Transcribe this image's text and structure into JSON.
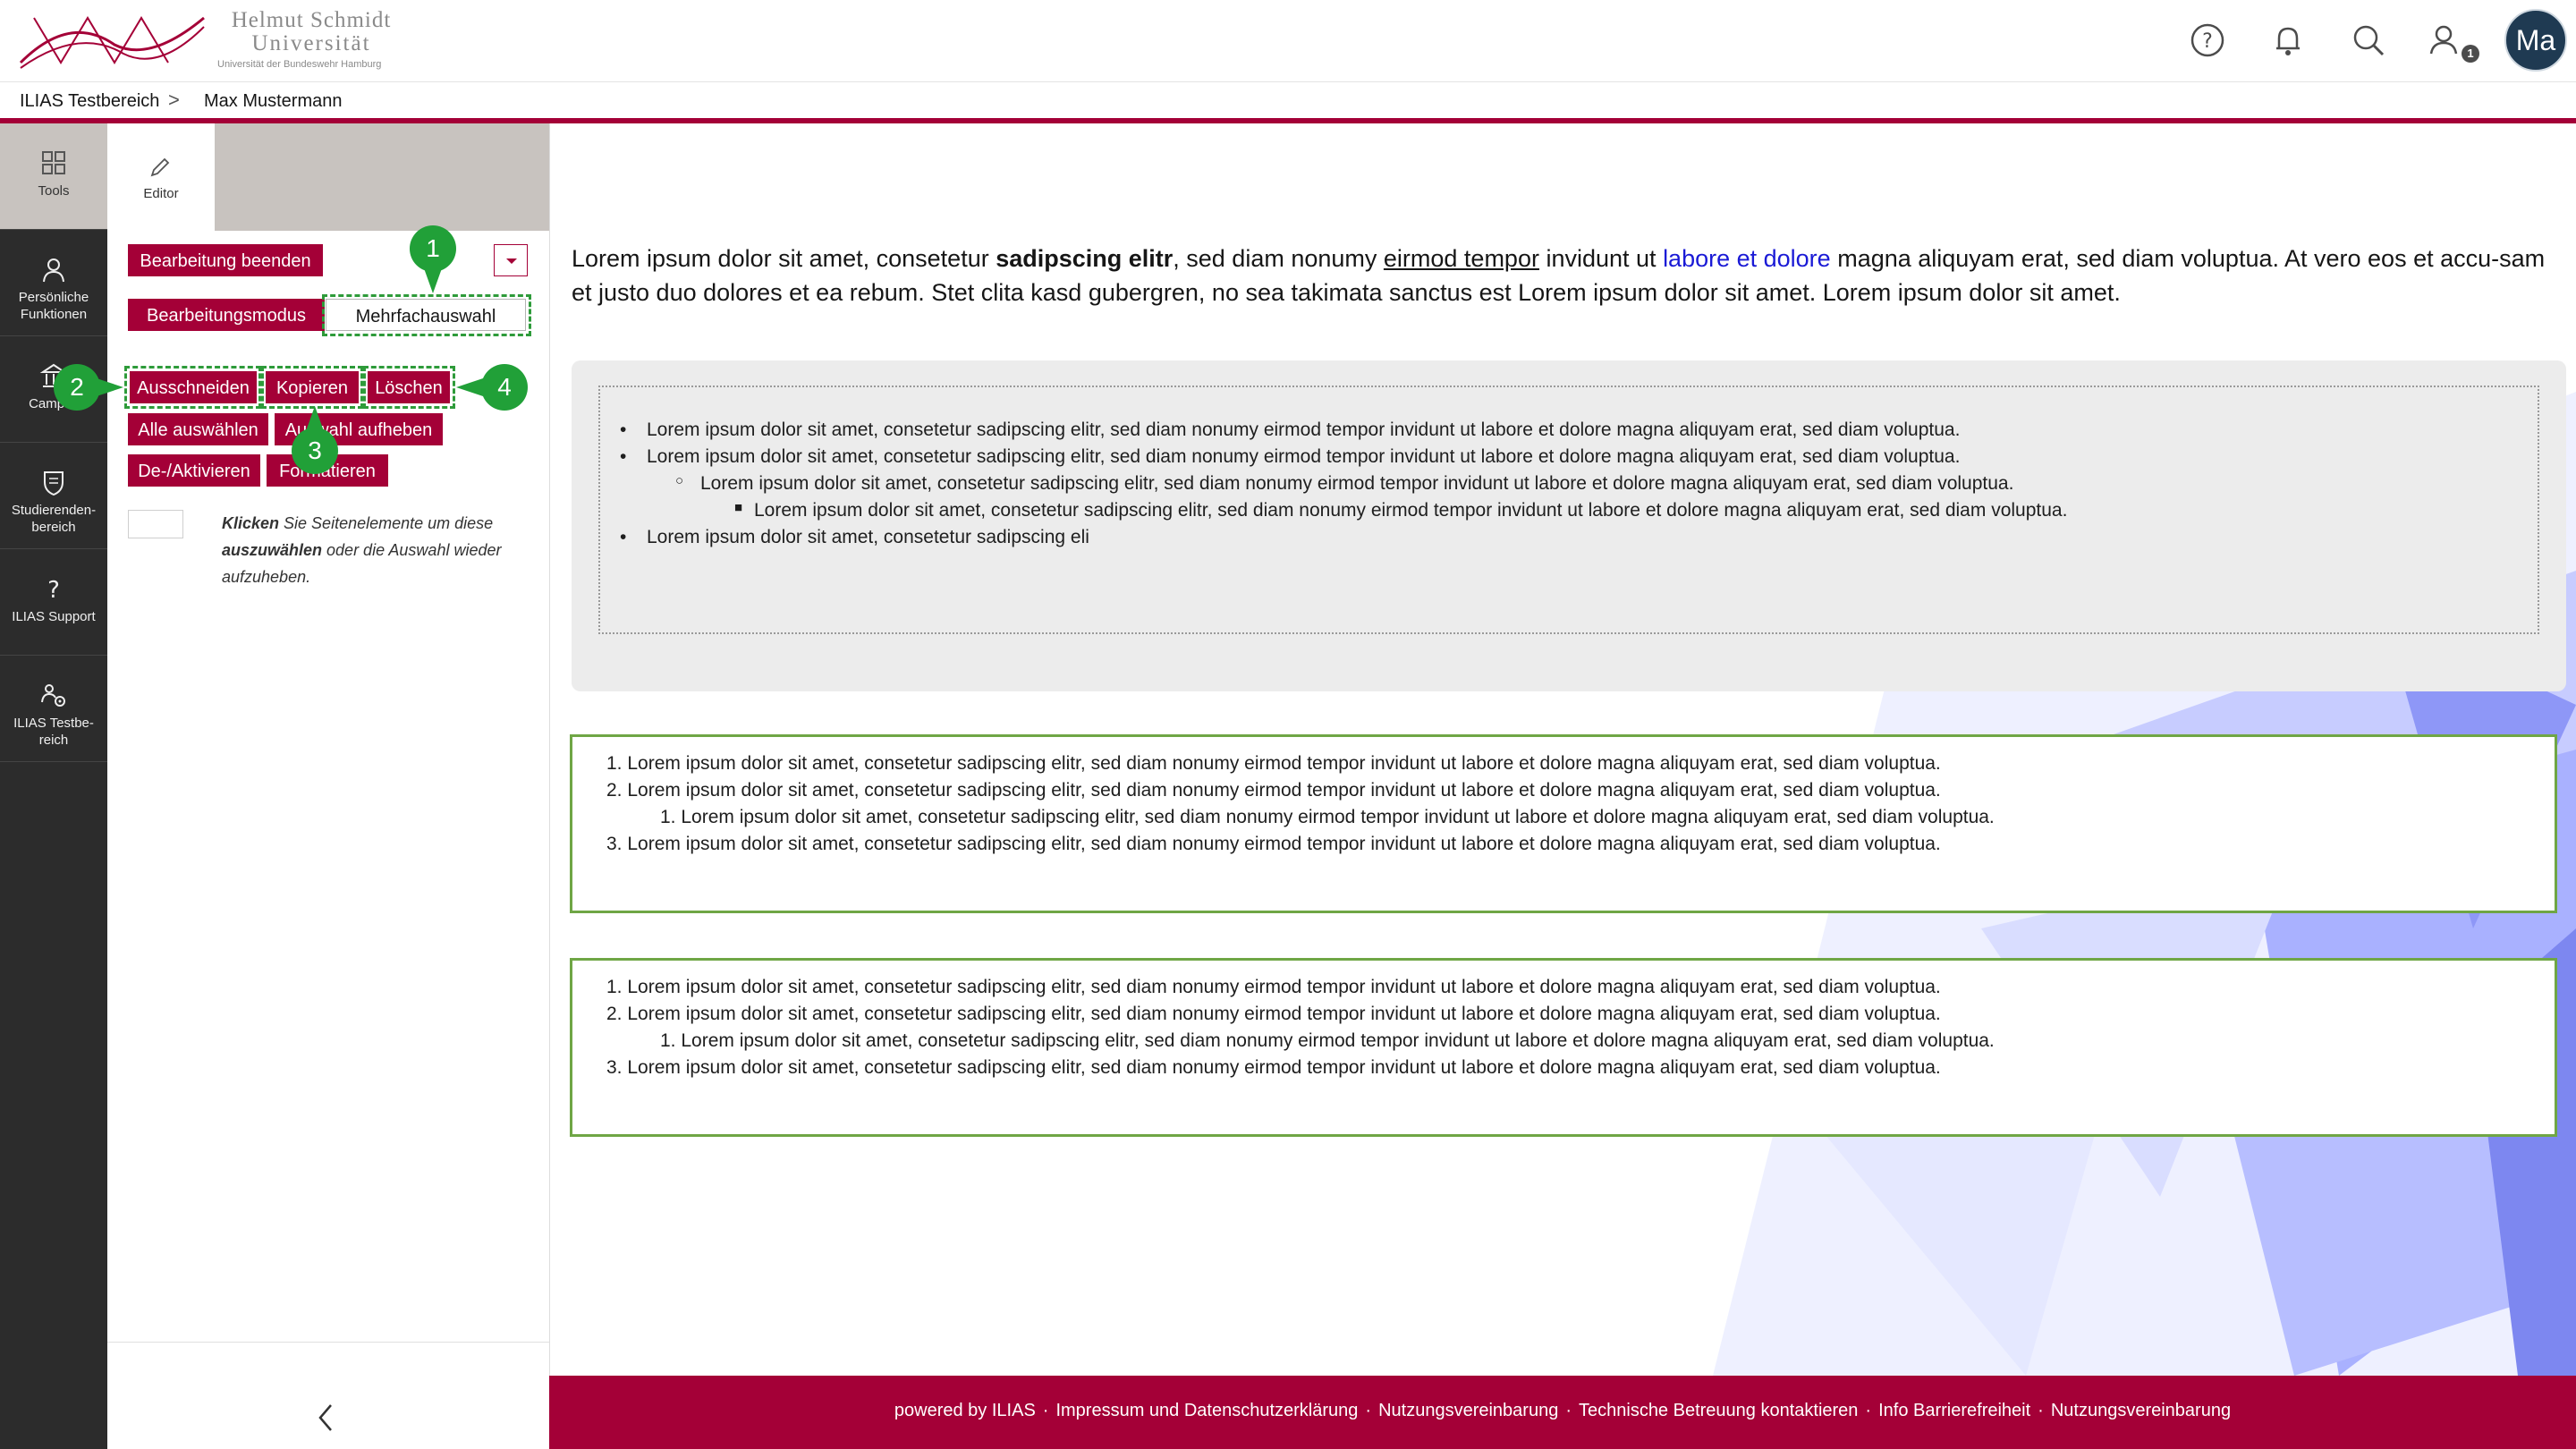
{
  "header": {
    "logo_line1": "Helmut Schmidt",
    "logo_line2": "Universität",
    "logo_sub": "Universität der Bundeswehr Hamburg",
    "avatar_initials": "Ma",
    "notification_count": "1",
    "icons": [
      "help-icon",
      "bell-icon",
      "search-icon",
      "user-icon"
    ]
  },
  "breadcrumb": {
    "items": [
      "ILIAS Testbereich",
      "Max Mustermann"
    ],
    "separator": ">"
  },
  "mainbar": {
    "items": [
      {
        "label": "Tools",
        "icon": "grid-icon"
      },
      {
        "label": "Persönliche Funktionen",
        "icon": "person-icon"
      },
      {
        "label": "Campus",
        "icon": "building-icon"
      },
      {
        "label": "Studierenden-bereich",
        "icon": "shield-icon"
      },
      {
        "label": "ILIAS Support",
        "icon": "question-icon"
      },
      {
        "label": "ILIAS Testbe-reich",
        "icon": "people-gear-icon"
      }
    ]
  },
  "toolpanel": {
    "tab_label": "Editor",
    "end_edit": "Bearbeitung beenden",
    "mode_edit": "Bearbeitungsmodus",
    "mode_multi": "Mehrfachauswahl",
    "actions": {
      "cut": "Ausschneiden",
      "copy": "Kopieren",
      "delete": "Löschen",
      "select_all": "Alle auswählen",
      "deselect": "Auswahl aufheben",
      "toggle": "De-/Aktivieren",
      "format": "Formatieren"
    },
    "hint_strong1": "Klicken",
    "hint_text1": " Sie Seitenelemente um diese ",
    "hint_strong2": "auszuwählen",
    "hint_text2": " oder die Auswahl wieder aufzuheben.",
    "callouts": [
      "1",
      "2",
      "3",
      "4"
    ]
  },
  "content": {
    "intro": {
      "p1": "Lorem ipsum dolor sit amet, consetetur ",
      "b1": "sadipscing elitr",
      "p2": ", sed diam nonumy ",
      "u1": "eirmod tempor",
      "p3": " invidunt ut ",
      "link1": "labore et dolore",
      "p4": " magna aliquyam erat, sed diam voluptua. At vero eos et accu-sam et justo duo dolores et ea rebum. Stet clita kasd gubergren, no sea takimata sanctus est Lorem ipsum dolor sit amet. Lorem ipsum dolor sit amet."
    },
    "bullet_list": [
      "Lorem ipsum dolor sit amet, consetetur sadipscing elitr, sed diam nonumy eirmod tempor invidunt ut labore et dolore magna aliquyam erat, sed diam voluptua.",
      "Lorem ipsum dolor sit amet, consetetur sadipscing elitr, sed diam nonumy eirmod tempor invidunt ut labore et dolore magna aliquyam erat, sed diam voluptua.",
      "Lorem ipsum dolor sit amet, consetetur sadipscing elitr, sed diam nonumy eirmod tempor invidunt ut labore et dolore magna aliquyam erat, sed diam voluptua.",
      "Lorem ipsum dolor sit amet, consetetur sadipscing elitr, sed diam nonumy eirmod tempor invidunt ut labore et dolore magna aliquyam erat, sed diam voluptua.",
      "Lorem ipsum dolor sit amet, consetetur sadipscing eli"
    ],
    "ordered_list_1": [
      "1. Lorem ipsum dolor sit amet, consetetur sadipscing elitr, sed diam nonumy eirmod tempor invidunt ut labore et dolore magna aliquyam erat, sed diam voluptua.",
      "2. Lorem ipsum dolor sit amet, consetetur sadipscing elitr, sed diam nonumy eirmod tempor invidunt ut labore et dolore magna aliquyam erat, sed diam voluptua.",
      "1. Lorem ipsum dolor sit amet, consetetur sadipscing elitr, sed diam nonumy eirmod tempor invidunt ut labore et dolore magna aliquyam erat, sed diam voluptua.",
      "3. Lorem ipsum dolor sit amet, consetetur sadipscing elitr, sed diam nonumy eirmod tempor invidunt ut labore et dolore magna aliquyam erat, sed diam voluptua."
    ],
    "ordered_list_2": [
      "1. Lorem ipsum dolor sit amet, consetetur sadipscing elitr, sed diam nonumy eirmod tempor invidunt ut labore et dolore magna aliquyam erat, sed diam voluptua.",
      "2. Lorem ipsum dolor sit amet, consetetur sadipscing elitr, sed diam nonumy eirmod tempor invidunt ut labore et dolore magna aliquyam erat, sed diam voluptua.",
      "1. Lorem ipsum dolor sit amet, consetetur sadipscing elitr, sed diam nonumy eirmod tempor invidunt ut labore et dolore magna aliquyam erat, sed diam voluptua.",
      "3. Lorem ipsum dolor sit amet, consetetur sadipscing elitr, sed diam nonumy eirmod tempor invidunt ut labore et dolore magna aliquyam erat, sed diam voluptua."
    ]
  },
  "footer": {
    "links": [
      "powered by ILIAS",
      "Impressum und Datenschutzerklärung",
      "Nutzungsvereinbarung",
      "Technische Betreuung kontaktieren",
      "Info Barrierefreiheit",
      "Nutzungsvereinbarung"
    ],
    "separator": "·"
  },
  "colors": {
    "brand": "#a40037",
    "callout": "#21a038",
    "slate": "#2c2c2c",
    "highlight_border": "#6fa645"
  }
}
